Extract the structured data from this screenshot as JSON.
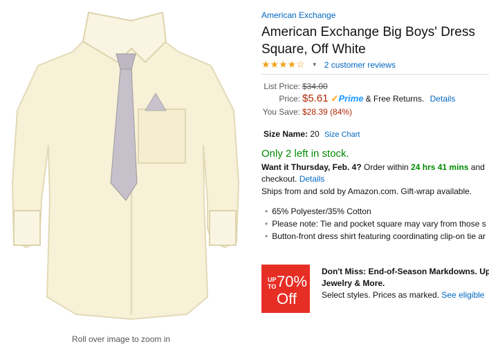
{
  "product": {
    "brand": "American Exchange",
    "title": "American Exchange Big Boys' Dress Square, Off White",
    "rating_stars": "★★★★☆",
    "reviews": "2 customer reviews",
    "image_alt": "Off-white dress shirt with patterned tie and pocket square",
    "zoom_hint": "Roll over image to zoom in"
  },
  "pricing": {
    "list_label": "List Price:",
    "list_price": "$34.00",
    "price_label": "Price:",
    "price": "$5.61",
    "prime_text": "Prime",
    "free_returns": "& Free Returns.",
    "details": "Details",
    "save_label": "You Save:",
    "save_value": "$28.39 (84%)"
  },
  "size": {
    "label": "Size Name:",
    "value": "20",
    "chart_link": "Size Chart"
  },
  "availability": {
    "stock": "Only 2 left in stock.",
    "want_it": "Want it Thursday, Feb. 4?",
    "order_within": "Order within",
    "countdown": "24 hrs 41 mins",
    "and": "and",
    "checkout": "checkout.",
    "details": "Details",
    "ships": "Ships from and sold by Amazon.com. Gift-wrap available."
  },
  "bullets": [
    "65% Polyester/35% Cotton",
    "Please note: Tie and pocket square may vary from those s",
    "Button-front dress shirt featuring coordinating clip-on tie ar"
  ],
  "promo": {
    "up_to": "UP TO",
    "percent": "70%",
    "off": "Off",
    "headline": "Don't Miss: End-of-Season Markdowns. Up",
    "headline2": "Jewelry & More.",
    "body": "Select styles. Prices as marked.",
    "link": "See eligible"
  },
  "colors": {
    "link": "#0066c0",
    "price": "#b12704",
    "in_stock": "#008a00",
    "star": "#f0a31b",
    "promo_badge": "#e62e25"
  }
}
